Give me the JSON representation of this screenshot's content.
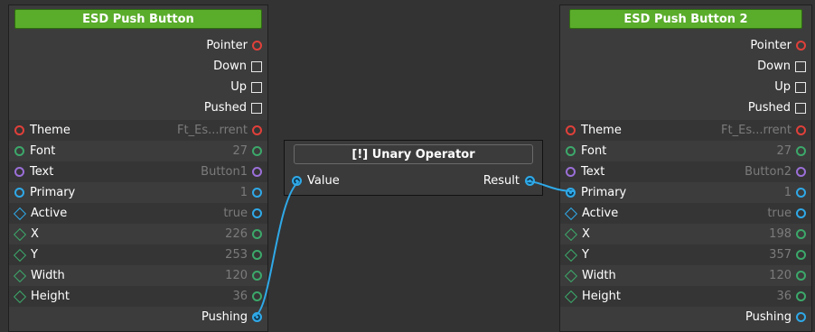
{
  "nodes": {
    "left": {
      "title": "ESD Push Button",
      "outputs": [
        "Pointer",
        "Down",
        "Up",
        "Pushed"
      ],
      "inputs": [
        {
          "label": "Theme",
          "value": "Ft_Es...rrent"
        },
        {
          "label": "Font",
          "value": "27"
        },
        {
          "label": "Text",
          "value": "Button1"
        },
        {
          "label": "Primary",
          "value": "1"
        },
        {
          "label": "Active",
          "value": "true"
        },
        {
          "label": "X",
          "value": "226"
        },
        {
          "label": "Y",
          "value": "253"
        },
        {
          "label": "Width",
          "value": "120"
        },
        {
          "label": "Height",
          "value": "36"
        }
      ],
      "bottom_output": "Pushing"
    },
    "middle": {
      "title": "[!] Unary Operator",
      "input": "Value",
      "output": "Result"
    },
    "right": {
      "title": "ESD Push Button 2",
      "outputs": [
        "Pointer",
        "Down",
        "Up",
        "Pushed"
      ],
      "inputs": [
        {
          "label": "Theme",
          "value": "Ft_Es...rrent"
        },
        {
          "label": "Font",
          "value": "27"
        },
        {
          "label": "Text",
          "value": "Button2"
        },
        {
          "label": "Primary",
          "value": "1"
        },
        {
          "label": "Active",
          "value": "true"
        },
        {
          "label": "X",
          "value": "198"
        },
        {
          "label": "Y",
          "value": "357"
        },
        {
          "label": "Width",
          "value": "120"
        },
        {
          "label": "Height",
          "value": "36"
        }
      ],
      "bottom_output": "Pushing"
    }
  },
  "colors": {
    "header_green": "#5aac2b",
    "port_red": "#e0403a",
    "port_green": "#3ca86a",
    "port_purple": "#9b6fd8",
    "port_blue": "#2fa9e8",
    "wire": "#2fa9e8"
  },
  "icons": {
    "pointer": "circle-port",
    "down": "square-port",
    "up": "square-port",
    "pushed": "square-port",
    "active_x_y_width_height": "diamond-port"
  }
}
